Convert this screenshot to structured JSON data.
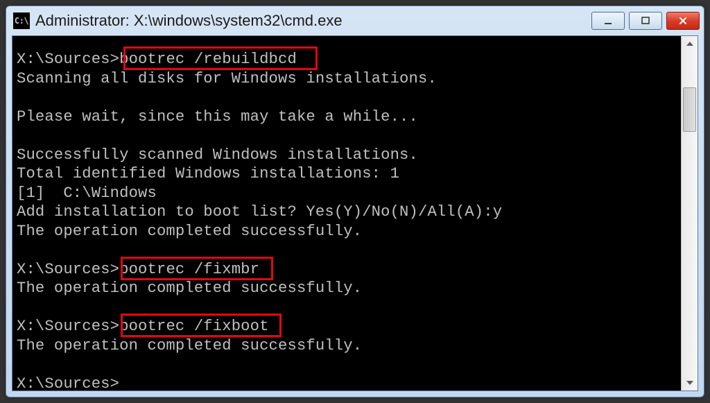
{
  "window": {
    "title": "Administrator: X:\\windows\\system32\\cmd.exe",
    "icon_label": "C:\\"
  },
  "terminal": {
    "line1_prompt": "X:\\Sources>",
    "line1_cmd": "bootrec /rebuildbcd",
    "line2": "Scanning all disks for Windows installations.",
    "line3": "",
    "line4": "Please wait, since this may take a while...",
    "line5": "",
    "line6": "Successfully scanned Windows installations.",
    "line7": "Total identified Windows installations: 1",
    "line8": "[1]  C:\\Windows",
    "line9": "Add installation to boot list? Yes(Y)/No(N)/All(A):y",
    "line10": "The operation completed successfully.",
    "line11": "",
    "line12_prompt": "X:\\Sources>",
    "line12_cmd": "bootrec /fixmbr",
    "line13": "The operation completed successfully.",
    "line14": "",
    "line15_prompt": "X:\\Sources>",
    "line15_cmd": "bootrec /fixboot",
    "line16": "The operation completed successfully.",
    "line17": "",
    "line18_prompt": "X:\\Sources>"
  },
  "highlights": [
    {
      "id": "hl-rebuildbcd",
      "target": "bootrec /rebuildbcd"
    },
    {
      "id": "hl-fixmbr",
      "target": "bootrec /fixmbr"
    },
    {
      "id": "hl-fixboot",
      "target": "bootrec /fixboot"
    }
  ]
}
